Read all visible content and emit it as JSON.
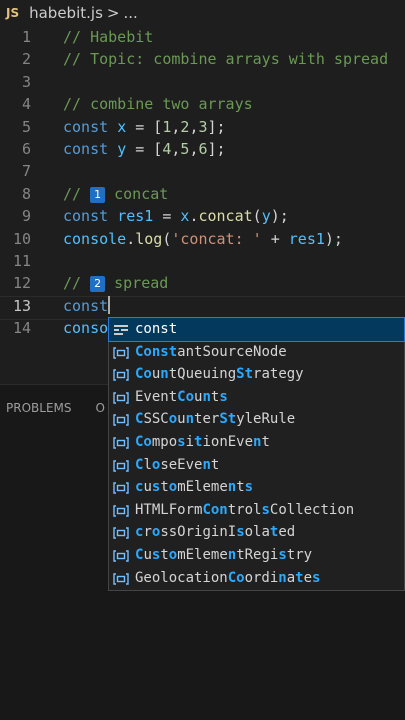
{
  "breadcrumb": {
    "badge": "JS",
    "file": "habebit.js",
    "sep": ">",
    "more": "..."
  },
  "editor": {
    "lines": [
      {
        "n": "1",
        "tokens": [
          {
            "c": "cm",
            "t": "// Habebit"
          }
        ]
      },
      {
        "n": "2",
        "tokens": [
          {
            "c": "cm",
            "t": "// Topic: combine arrays with spread"
          }
        ]
      },
      {
        "n": "3",
        "tokens": []
      },
      {
        "n": "4",
        "tokens": [
          {
            "c": "cm",
            "t": "// combine two arrays"
          }
        ]
      },
      {
        "n": "5",
        "tokens": [
          {
            "c": "kw",
            "t": "const "
          },
          {
            "c": "var",
            "t": "x"
          },
          {
            "c": "pl",
            "t": " = ["
          },
          {
            "c": "num",
            "t": "1"
          },
          {
            "c": "pl",
            "t": ","
          },
          {
            "c": "num",
            "t": "2"
          },
          {
            "c": "pl",
            "t": ","
          },
          {
            "c": "num",
            "t": "3"
          },
          {
            "c": "pl",
            "t": "];"
          }
        ]
      },
      {
        "n": "6",
        "tokens": [
          {
            "c": "kw",
            "t": "const "
          },
          {
            "c": "var",
            "t": "y"
          },
          {
            "c": "pl",
            "t": " = ["
          },
          {
            "c": "num",
            "t": "4"
          },
          {
            "c": "pl",
            "t": ","
          },
          {
            "c": "num",
            "t": "5"
          },
          {
            "c": "pl",
            "t": ","
          },
          {
            "c": "num",
            "t": "6"
          },
          {
            "c": "pl",
            "t": "];"
          }
        ]
      },
      {
        "n": "7",
        "tokens": []
      },
      {
        "n": "8",
        "tokens": [
          {
            "c": "cm",
            "t": "// "
          },
          {
            "c": "badge",
            "t": "1"
          },
          {
            "c": "cm",
            "t": " concat"
          }
        ]
      },
      {
        "n": "9",
        "tokens": [
          {
            "c": "kw",
            "t": "const "
          },
          {
            "c": "var",
            "t": "res1"
          },
          {
            "c": "pl",
            "t": " = "
          },
          {
            "c": "var",
            "t": "x"
          },
          {
            "c": "pl",
            "t": "."
          },
          {
            "c": "fn",
            "t": "concat"
          },
          {
            "c": "pl",
            "t": "("
          },
          {
            "c": "var",
            "t": "y"
          },
          {
            "c": "pl",
            "t": ");"
          }
        ]
      },
      {
        "n": "10",
        "tokens": [
          {
            "c": "var",
            "t": "console"
          },
          {
            "c": "pl",
            "t": "."
          },
          {
            "c": "fn",
            "t": "log"
          },
          {
            "c": "pl",
            "t": "("
          },
          {
            "c": "str",
            "t": "'concat: '"
          },
          {
            "c": "pl",
            "t": " + "
          },
          {
            "c": "var",
            "t": "res1"
          },
          {
            "c": "pl",
            "t": ");"
          }
        ]
      },
      {
        "n": "11",
        "tokens": []
      },
      {
        "n": "12",
        "tokens": [
          {
            "c": "cm",
            "t": "// "
          },
          {
            "c": "badge",
            "t": "2"
          },
          {
            "c": "cm",
            "t": " spread"
          }
        ]
      },
      {
        "n": "13",
        "tokens": [
          {
            "c": "kw",
            "t": "const"
          },
          {
            "c": "cursor",
            "t": ""
          }
        ]
      },
      {
        "n": "14",
        "tokens": [
          {
            "c": "var",
            "t": "conso"
          }
        ]
      }
    ],
    "active_line": "13"
  },
  "panel": {
    "tabs": [
      "PROBLEMS",
      "O"
    ]
  },
  "suggest": {
    "items": [
      {
        "icon": "keyword-icon",
        "selected": true,
        "parts": [
          {
            "h": false,
            "t": "const"
          }
        ]
      },
      {
        "icon": "variable-icon",
        "parts": [
          {
            "h": true,
            "t": "Const"
          },
          {
            "h": false,
            "t": "antSourceNode"
          }
        ]
      },
      {
        "icon": "variable-icon",
        "parts": [
          {
            "h": true,
            "t": "Co"
          },
          {
            "h": false,
            "t": "u"
          },
          {
            "h": true,
            "t": "n"
          },
          {
            "h": false,
            "t": "tQueuing"
          },
          {
            "h": true,
            "t": "St"
          },
          {
            "h": false,
            "t": "rategy"
          }
        ]
      },
      {
        "icon": "variable-icon",
        "parts": [
          {
            "h": false,
            "t": "Event"
          },
          {
            "h": true,
            "t": "Co"
          },
          {
            "h": false,
            "t": "u"
          },
          {
            "h": true,
            "t": "n"
          },
          {
            "h": false,
            "t": "t"
          },
          {
            "h": true,
            "t": "s"
          }
        ]
      },
      {
        "icon": "variable-icon",
        "parts": [
          {
            "h": true,
            "t": "C"
          },
          {
            "h": false,
            "t": "SSC"
          },
          {
            "h": true,
            "t": "o"
          },
          {
            "h": false,
            "t": "u"
          },
          {
            "h": true,
            "t": "n"
          },
          {
            "h": false,
            "t": "ter"
          },
          {
            "h": true,
            "t": "St"
          },
          {
            "h": false,
            "t": "yleRule"
          }
        ]
      },
      {
        "icon": "variable-icon",
        "parts": [
          {
            "h": true,
            "t": "Co"
          },
          {
            "h": false,
            "t": "mpo"
          },
          {
            "h": true,
            "t": "s"
          },
          {
            "h": false,
            "t": "i"
          },
          {
            "h": true,
            "t": "t"
          },
          {
            "h": false,
            "t": "ionEve"
          },
          {
            "h": true,
            "t": "n"
          },
          {
            "h": false,
            "t": "t"
          }
        ]
      },
      {
        "icon": "variable-icon",
        "parts": [
          {
            "h": true,
            "t": "C"
          },
          {
            "h": false,
            "t": "l"
          },
          {
            "h": true,
            "t": "o"
          },
          {
            "h": false,
            "t": "seEve"
          },
          {
            "h": true,
            "t": "n"
          },
          {
            "h": false,
            "t": "t"
          }
        ]
      },
      {
        "icon": "variable-icon",
        "parts": [
          {
            "h": true,
            "t": "c"
          },
          {
            "h": false,
            "t": "u"
          },
          {
            "h": true,
            "t": "s"
          },
          {
            "h": false,
            "t": "t"
          },
          {
            "h": true,
            "t": "o"
          },
          {
            "h": false,
            "t": "mEleme"
          },
          {
            "h": true,
            "t": "n"
          },
          {
            "h": false,
            "t": "t"
          },
          {
            "h": true,
            "t": "s"
          }
        ]
      },
      {
        "icon": "variable-icon",
        "parts": [
          {
            "h": false,
            "t": "HTMLForm"
          },
          {
            "h": true,
            "t": "Con"
          },
          {
            "h": false,
            "t": "t"
          },
          {
            "h": false,
            "t": "rol"
          },
          {
            "h": true,
            "t": "s"
          },
          {
            "h": false,
            "t": "Collection"
          }
        ]
      },
      {
        "icon": "variable-icon",
        "parts": [
          {
            "h": true,
            "t": "c"
          },
          {
            "h": false,
            "t": "r"
          },
          {
            "h": true,
            "t": "o"
          },
          {
            "h": false,
            "t": "ss"
          },
          {
            "h": false,
            "t": "OriginI"
          },
          {
            "h": true,
            "t": "s"
          },
          {
            "h": false,
            "t": "ola"
          },
          {
            "h": true,
            "t": "t"
          },
          {
            "h": false,
            "t": "ed"
          }
        ]
      },
      {
        "icon": "variable-icon",
        "parts": [
          {
            "h": true,
            "t": "C"
          },
          {
            "h": false,
            "t": "u"
          },
          {
            "h": true,
            "t": "s"
          },
          {
            "h": false,
            "t": "t"
          },
          {
            "h": true,
            "t": "o"
          },
          {
            "h": false,
            "t": "mEleme"
          },
          {
            "h": true,
            "t": "n"
          },
          {
            "h": false,
            "t": "tRegi"
          },
          {
            "h": true,
            "t": "s"
          },
          {
            "h": false,
            "t": "t"
          },
          {
            "h": false,
            "t": "ry"
          }
        ]
      },
      {
        "icon": "variable-icon",
        "parts": [
          {
            "h": false,
            "t": "Geolocation"
          },
          {
            "h": true,
            "t": "Co"
          },
          {
            "h": false,
            "t": "ordi"
          },
          {
            "h": true,
            "t": "n"
          },
          {
            "h": false,
            "t": "a"
          },
          {
            "h": true,
            "t": "t"
          },
          {
            "h": false,
            "t": "e"
          },
          {
            "h": true,
            "t": "s"
          }
        ]
      }
    ]
  },
  "colors": {
    "background": "#1e1e1e",
    "selection": "#04395e",
    "match": "#2aaaff",
    "keyword": "#569cd6",
    "comment": "#6a9955"
  }
}
